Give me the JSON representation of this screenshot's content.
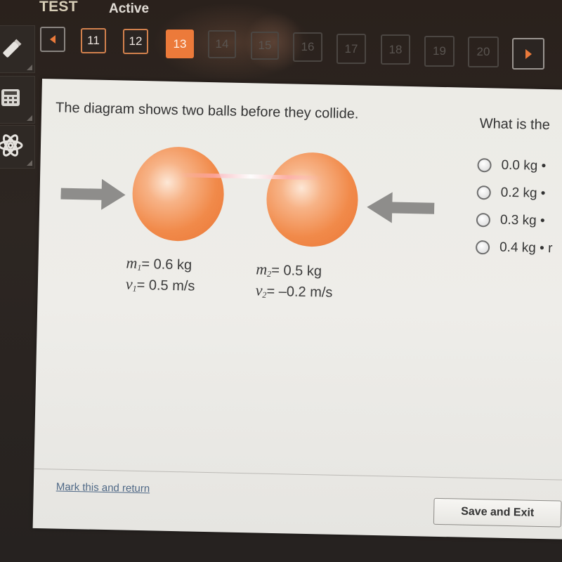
{
  "header": {
    "title": "TEST",
    "status": "Active"
  },
  "tools": [
    {
      "name": "pencil-icon"
    },
    {
      "name": "calculator-icon"
    },
    {
      "name": "atom-icon"
    }
  ],
  "navigation": {
    "prev_icon": "chevron-left-icon",
    "next_icon": "chevron-right-icon",
    "current": "13",
    "questions": [
      {
        "label": "11",
        "state": "visited"
      },
      {
        "label": "12",
        "state": "visited"
      },
      {
        "label": "13",
        "state": "current"
      },
      {
        "label": "14",
        "state": "future"
      },
      {
        "label": "15",
        "state": "future"
      },
      {
        "label": "16",
        "state": "future"
      },
      {
        "label": "17",
        "state": "future"
      },
      {
        "label": "18",
        "state": "future"
      },
      {
        "label": "19",
        "state": "future"
      },
      {
        "label": "20",
        "state": "future"
      }
    ],
    "accent_color": "#ec7a3a"
  },
  "question": {
    "prompt": "The diagram shows two balls before they collide.",
    "right_prompt": "What is the",
    "diagram": {
      "ball1": {
        "mass_label": "m",
        "mass_sub": "1",
        "mass_value": "= 0.6 kg",
        "vel_label": "v",
        "vel_sub": "1",
        "vel_value": "= 0.5 m/s"
      },
      "ball2": {
        "mass_label": "m",
        "mass_sub": "2",
        "mass_value": "= 0.5 kg",
        "vel_label": "v",
        "vel_sub": "2",
        "vel_value": "= –0.2 m/s"
      },
      "ball_color": "#f18a4a",
      "arrow_color": "#8a8a8a"
    },
    "answers": [
      {
        "label": "0.0 kg •"
      },
      {
        "label": "0.2 kg •"
      },
      {
        "label": "0.3 kg •"
      },
      {
        "label": "0.4 kg • r"
      }
    ]
  },
  "footer": {
    "mark_link": "Mark this and return",
    "save_button": "Save and Exit"
  }
}
